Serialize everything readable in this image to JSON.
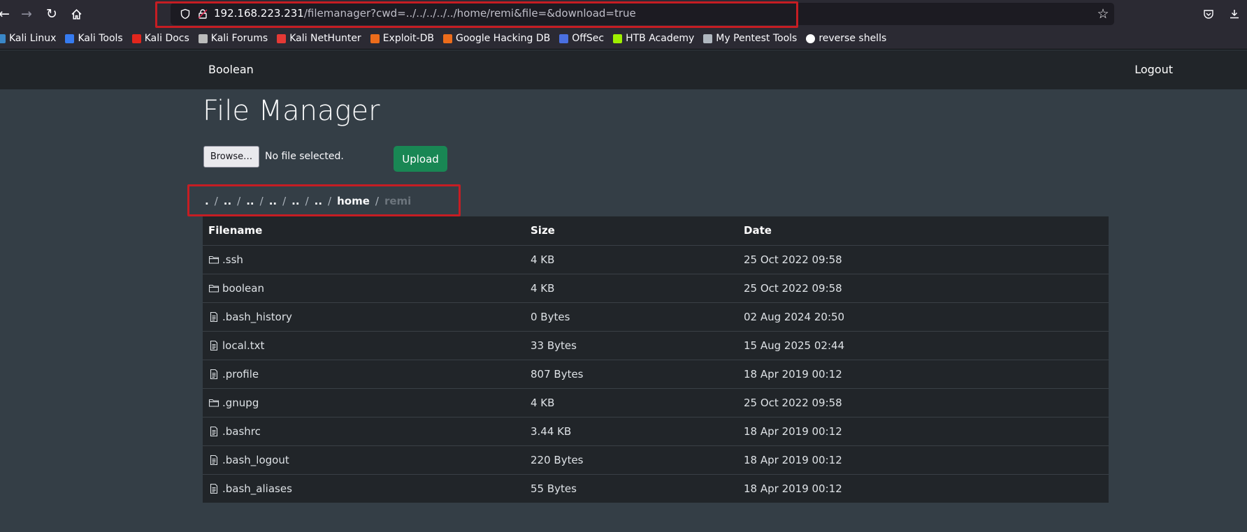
{
  "browser": {
    "url_host": "192.168.223.231",
    "url_path": "/filemanager?cwd=../../../../../home/remi&file=&download=true",
    "bookmarks": [
      {
        "label": "Kali Linux",
        "icon": "kali-dragon-icon",
        "color": "#3a87c8"
      },
      {
        "label": "Kali Tools",
        "icon": "kali-tools-icon",
        "color": "#367bf0"
      },
      {
        "label": "Kali Docs",
        "icon": "kali-docs-icon",
        "color": "#e2261d"
      },
      {
        "label": "Kali Forums",
        "icon": "kali-forums-icon",
        "color": "#bbbbbb"
      },
      {
        "label": "Kali NetHunter",
        "icon": "nethunter-icon",
        "color": "#e53935"
      },
      {
        "label": "Exploit-DB",
        "icon": "exploit-db-icon",
        "color": "#ec6c1b"
      },
      {
        "label": "Google Hacking DB",
        "icon": "ghdb-icon",
        "color": "#ec6c1b"
      },
      {
        "label": "OffSec",
        "icon": "offsec-icon",
        "color": "#4a6fe0"
      },
      {
        "label": "HTB Academy",
        "icon": "htb-academy-icon",
        "color": "#9fef00"
      },
      {
        "label": "My Pentest Tools",
        "icon": "pentest-tools-icon",
        "color": "#b0b8c0"
      },
      {
        "label": "reverse shells",
        "icon": "github-icon",
        "color": "#ffffff"
      }
    ]
  },
  "navbar": {
    "brand": "Boolean",
    "logout": "Logout"
  },
  "main": {
    "title": "File Manager",
    "browse_label": "Browse…",
    "no_file_label": "No file selected.",
    "upload_label": "Upload",
    "breadcrumb": [
      ".",
      "..",
      "..",
      "..",
      "..",
      "..",
      "home"
    ],
    "breadcrumb_active": "remi"
  },
  "table": {
    "headers": [
      "Filename",
      "Size",
      "Date"
    ],
    "rows": [
      {
        "name": ".ssh",
        "type": "folder",
        "size": "4 KB",
        "date": "25 Oct 2022 09:58"
      },
      {
        "name": "boolean",
        "type": "folder",
        "size": "4 KB",
        "date": "25 Oct 2022 09:58"
      },
      {
        "name": ".bash_history",
        "type": "file",
        "size": "0 Bytes",
        "date": "02 Aug 2024 20:50"
      },
      {
        "name": "local.txt",
        "type": "file",
        "size": "33 Bytes",
        "date": "15 Aug 2025 02:44"
      },
      {
        "name": ".profile",
        "type": "file",
        "size": "807 Bytes",
        "date": "18 Apr 2019 00:12"
      },
      {
        "name": ".gnupg",
        "type": "folder",
        "size": "4 KB",
        "date": "25 Oct 2022 09:58"
      },
      {
        "name": ".bashrc",
        "type": "file",
        "size": "3.44 KB",
        "date": "18 Apr 2019 00:12"
      },
      {
        "name": ".bash_logout",
        "type": "file",
        "size": "220 Bytes",
        "date": "18 Apr 2019 00:12"
      },
      {
        "name": ".bash_aliases",
        "type": "file",
        "size": "55 Bytes",
        "date": "18 Apr 2019 00:12"
      }
    ]
  },
  "colors": {
    "page_bg": "#343e46",
    "navbar_bg": "#212529",
    "upload_green": "#198754",
    "highlight_red": "#c61d23"
  }
}
